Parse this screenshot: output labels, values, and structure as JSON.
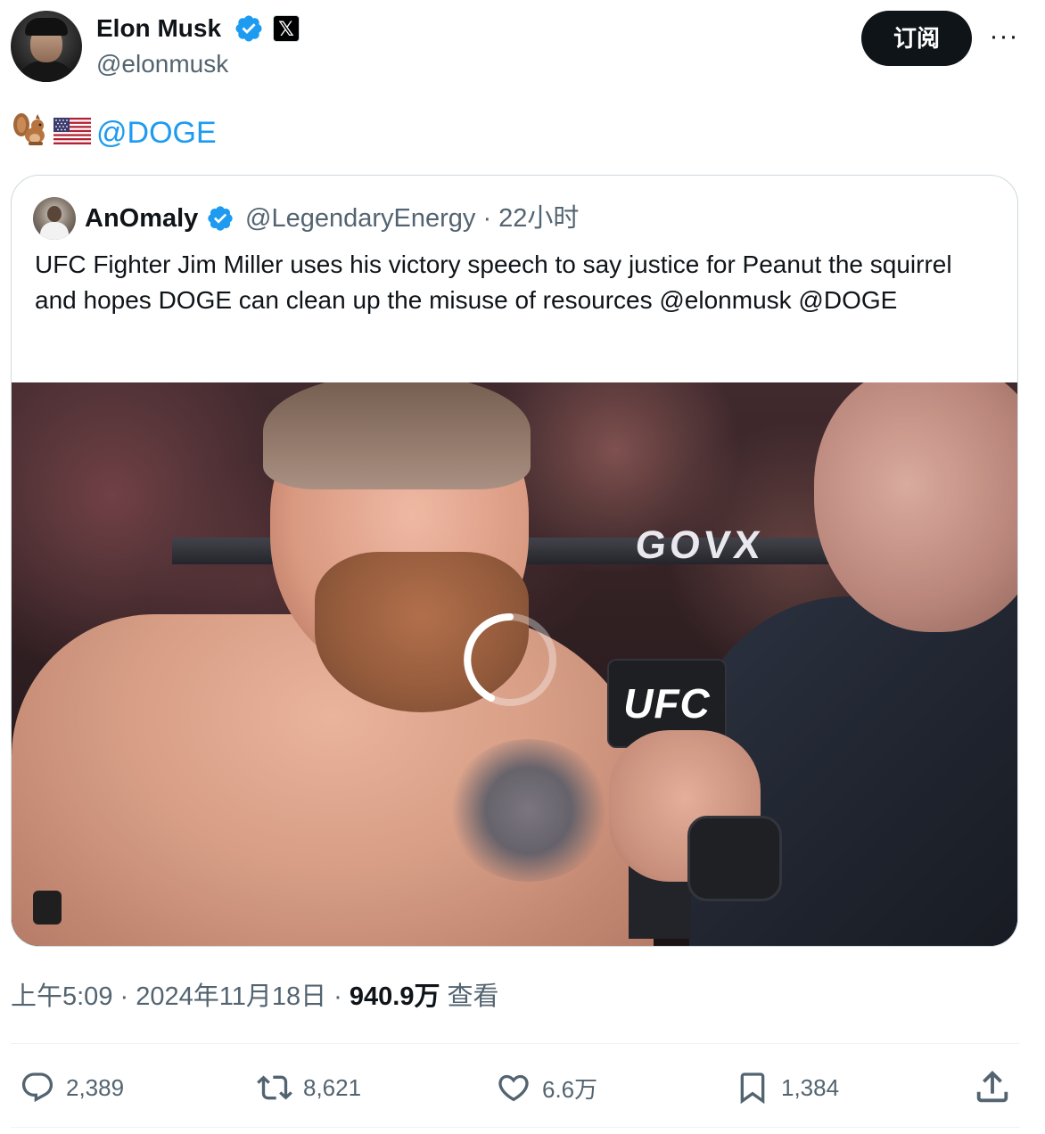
{
  "author": {
    "display_name": "Elon Musk",
    "handle": "@elonmusk",
    "affiliate_badge": "𝕏"
  },
  "header": {
    "subscribe_label": "订阅",
    "more_label": "···"
  },
  "tweet": {
    "emojis": [
      "squirrel-emoji",
      "us-flag-emoji"
    ],
    "mention": "@DOGE"
  },
  "quoted_tweet": {
    "display_name": "AnOmaly",
    "meta": "@LegendaryEnergy · 22小时",
    "text": "UFC Fighter Jim Miller uses his victory speech to say justice for Peanut the squirrel and hopes DOGE can clean up the misuse of resources @elonmusk @DOGE",
    "video": {
      "banner_text": "GOVX",
      "mic_text": "UFC",
      "state": "loading"
    }
  },
  "timestamp": {
    "time_date": "上午5:09 · 2024年11月18日 · ",
    "views_count": "940.9万",
    "views_label": " 查看"
  },
  "actions": {
    "replies": "2,389",
    "reposts": "8,621",
    "likes": "6.6万",
    "bookmarks": "1,384"
  },
  "colors": {
    "link": "#1d9bf0",
    "verified": "#1d9bf0",
    "text_secondary": "#536471",
    "subscribe_bg": "#0f1419",
    "divider": "#eff3f4"
  },
  "icons": [
    "verified-badge-icon",
    "x-affiliate-icon",
    "more-icon",
    "reply-icon",
    "repost-icon",
    "like-icon",
    "bookmark-icon",
    "share-icon",
    "loading-spinner-icon"
  ]
}
